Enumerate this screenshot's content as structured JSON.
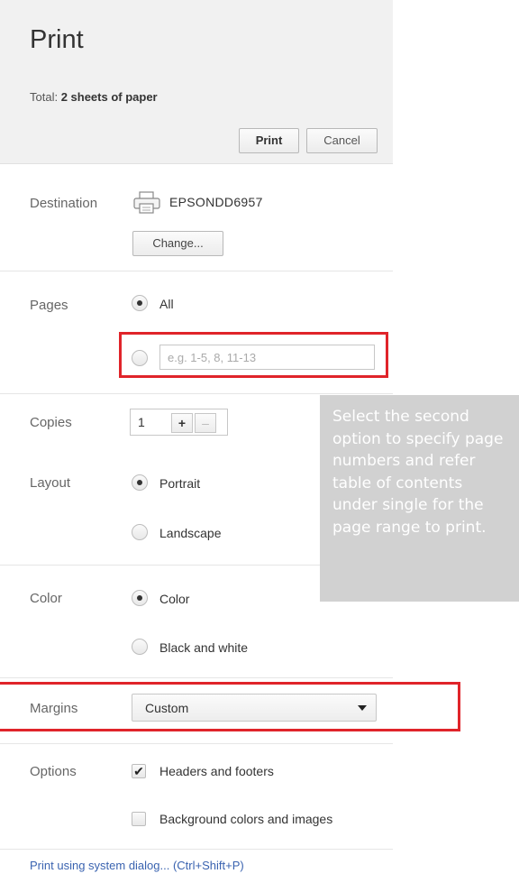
{
  "header": {
    "title": "Print",
    "total_prefix": "Total: ",
    "total_value": "2 sheets of paper",
    "print_button": "Print",
    "cancel_button": "Cancel"
  },
  "destination": {
    "label": "Destination",
    "printer_name": "EPSONDD6957",
    "change_button": "Change..."
  },
  "pages": {
    "label": "Pages",
    "option_all": "All",
    "option_all_selected": true,
    "range_placeholder": "e.g. 1-5, 8, 11-13"
  },
  "copies": {
    "label": "Copies",
    "value": "1",
    "plus": "+",
    "minus": "–"
  },
  "layout": {
    "label": "Layout",
    "options": [
      "Portrait",
      "Landscape"
    ],
    "selected": "Portrait"
  },
  "color": {
    "label": "Color",
    "options": [
      "Color",
      "Black and white"
    ],
    "selected": "Color"
  },
  "margins": {
    "label": "Margins",
    "selected": "Custom"
  },
  "options": {
    "label": "Options",
    "items": [
      {
        "label": "Headers and footers",
        "checked": true
      },
      {
        "label": "Background colors and images",
        "checked": false
      }
    ]
  },
  "footer": {
    "system_dialog_link": "Print using system dialog... (Ctrl+Shift+P)"
  },
  "annotation": {
    "text": "Select the second option to specify page numbers and refer table of contents under single for the page range to print.",
    "highlight_color": "#e0242a"
  }
}
